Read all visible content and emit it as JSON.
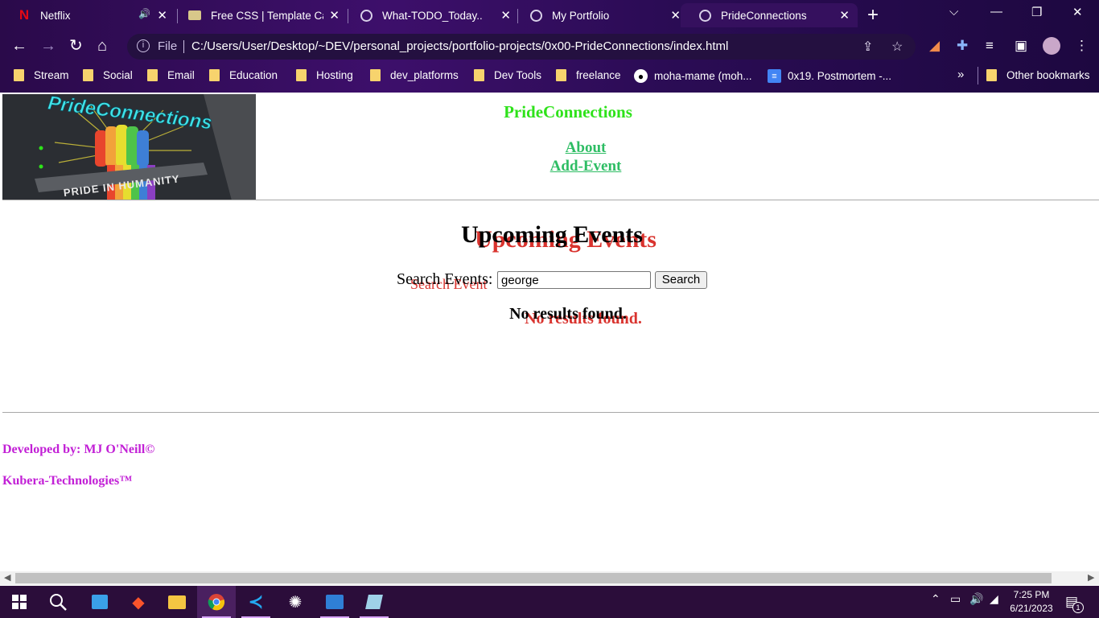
{
  "browser": {
    "tabs": [
      {
        "title": "Netflix",
        "icon": "netflix-icon"
      },
      {
        "title": "Free CSS | Template Cat",
        "icon": "freecss-icon"
      },
      {
        "title": "What-TODO_Today..",
        "icon": "globe-icon"
      },
      {
        "title": "My Portfolio",
        "icon": "globe-icon"
      },
      {
        "title": "PrideConnections",
        "icon": "globe-icon",
        "active": true
      }
    ],
    "address": {
      "scheme_label": "File",
      "url": "C:/Users/User/Desktop/~DEV/personal_projects/portfolio-projects/0x00-PrideConnections/index.html"
    },
    "bookmarks": [
      {
        "label": "Stream"
      },
      {
        "label": "Social"
      },
      {
        "label": "Email"
      },
      {
        "label": "Education"
      },
      {
        "label": "Hosting"
      },
      {
        "label": "dev_platforms"
      },
      {
        "label": "Dev Tools"
      },
      {
        "label": "freelance"
      },
      {
        "label": "moha-mame (moh..."
      },
      {
        "label": "0x19. Postmortem -..."
      }
    ],
    "bookmarks_overflow": "»",
    "other_bookmarks": "Other bookmarks"
  },
  "page": {
    "site_title": "PrideConnections",
    "logo_text": "PrideConnections",
    "logo_tagline": "PRIDE IN HUMANITY",
    "nav": [
      {
        "label": "About"
      },
      {
        "label": "Add-Event"
      }
    ],
    "heading": "Upcoming Events",
    "search": {
      "label": "Search Events:",
      "ghost_label": "Search Event",
      "value": "george",
      "button": "Search"
    },
    "result_message": "No results found.",
    "footer": {
      "developer": "Developed by: MJ O'Neill©",
      "company": "Kubera-Technologies™"
    }
  },
  "taskbar": {
    "time": "7:25 PM",
    "date": "6/21/2023",
    "notification_count": "1"
  },
  "colors": {
    "site_title": "#2ee21a",
    "nav_link": "#2ebd64",
    "ghost_text": "#d9332e",
    "footer_text": "#c220d6",
    "chrome_bg": "#3d0f6b"
  }
}
